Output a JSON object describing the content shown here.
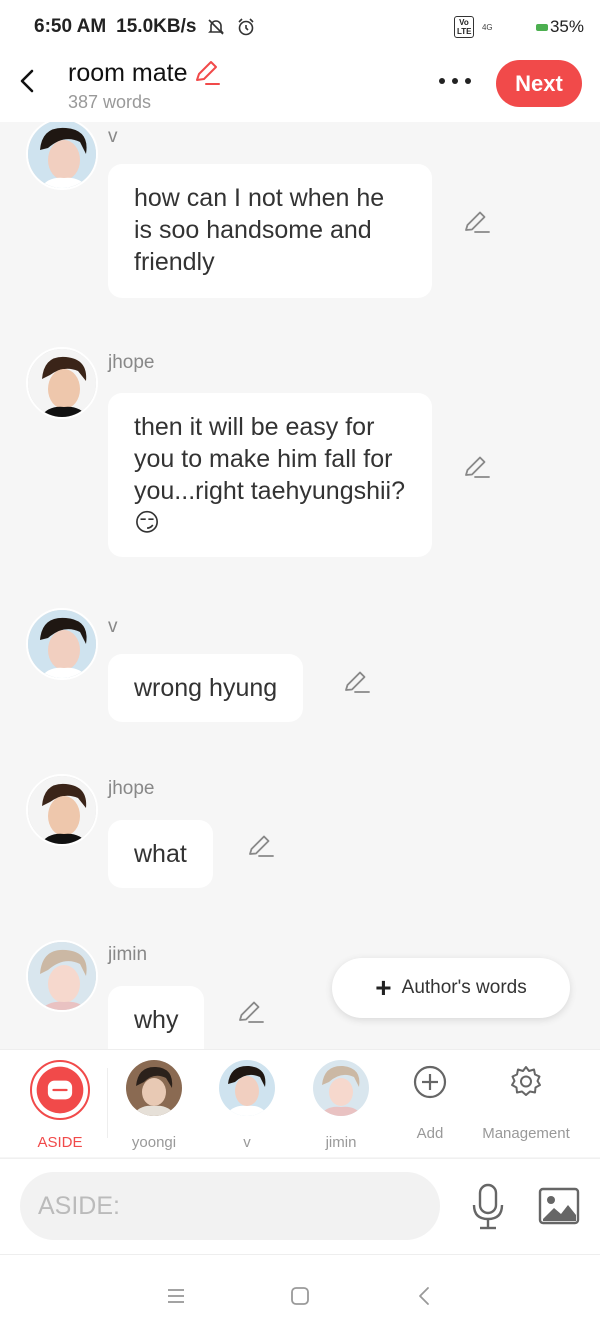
{
  "status": {
    "time": "6:50 AM",
    "speed": "15.0KB/s",
    "volte": "Vo LTE",
    "network": "4G",
    "battery": "35%"
  },
  "header": {
    "title": "room mate",
    "word_count": "387 words",
    "next_label": "Next"
  },
  "messages": [
    {
      "sender": "v",
      "text": "how can I not when he is soo handsome and friendly"
    },
    {
      "sender": "jhope",
      "text": "then it will be easy for you to make him fall for you...right taehyungshii? 😏"
    },
    {
      "sender": "v",
      "text": "wrong hyung"
    },
    {
      "sender": "jhope",
      "text": "what"
    },
    {
      "sender": "jimin",
      "text": "why"
    }
  ],
  "authors_words_label": "Author's words",
  "characters": [
    {
      "label": "ASIDE"
    },
    {
      "label": "yoongi"
    },
    {
      "label": "v"
    },
    {
      "label": "jimin"
    }
  ],
  "tools": {
    "add_label": "Add",
    "management_label": "Management"
  },
  "input": {
    "placeholder": "ASIDE:"
  },
  "colors": {
    "accent": "#f14a4a",
    "background": "#f6f6f6",
    "bubble": "#ffffff"
  }
}
